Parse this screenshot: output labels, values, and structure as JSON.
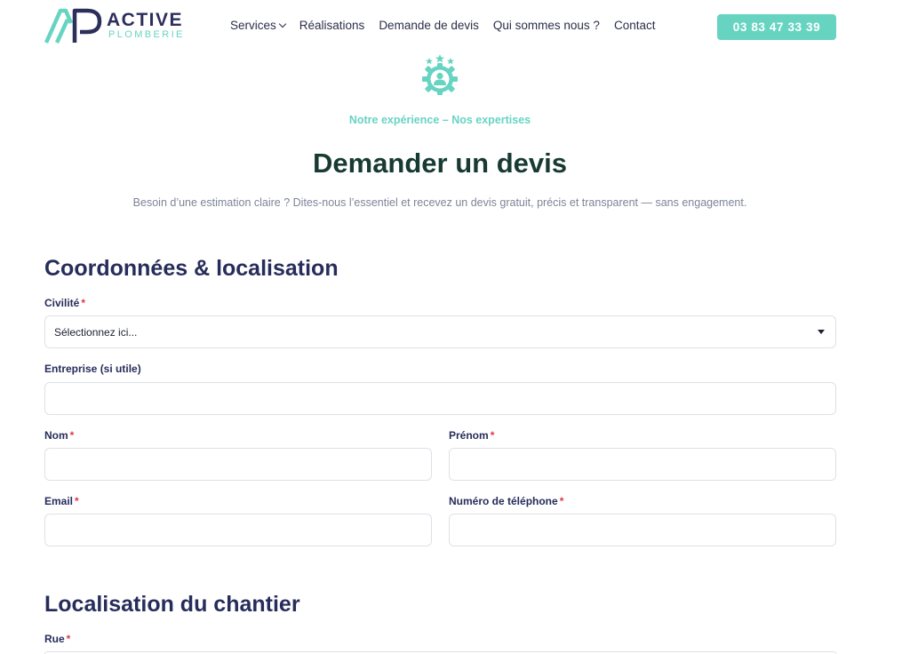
{
  "brand": {
    "name": "ACTIVE",
    "tagline": "PLOMBERIE",
    "accent_color": "#67d4c2",
    "navy_color": "#2b2f5a"
  },
  "nav": {
    "items": [
      {
        "label": "Services",
        "has_dropdown": true
      },
      {
        "label": "Réalisations"
      },
      {
        "label": "Demande de devis"
      },
      {
        "label": "Qui sommes nous ?"
      },
      {
        "label": "Contact"
      }
    ],
    "phone": "03 83 47 33 39"
  },
  "hero": {
    "icon": "team-gear-stars-icon",
    "eyebrow": "Notre expérience – Nos expertises",
    "title": "Demander un devis",
    "intro": "Besoin d’une estimation claire ? Dites-nous l’essentiel et recevez un devis gratuit, précis et transparent — sans engagement."
  },
  "form": {
    "section1": {
      "title": "Coordonnées & localisation",
      "civilite": {
        "label": "Civilité",
        "required": "*",
        "value": "Sélectionnez ici..."
      },
      "entreprise": {
        "label": "Entreprise (si utile)",
        "value": ""
      },
      "nom": {
        "label": "Nom",
        "required": "*",
        "value": ""
      },
      "prenom": {
        "label": "Prénom",
        "required": "*",
        "value": ""
      },
      "email": {
        "label": "Email",
        "required": "*",
        "value": ""
      },
      "telephone": {
        "label": "Numéro de téléphone",
        "required": "*",
        "value": ""
      }
    },
    "section2": {
      "title": "Localisation du chantier",
      "rue": {
        "label": "Rue",
        "required": "*",
        "value": ""
      }
    }
  }
}
